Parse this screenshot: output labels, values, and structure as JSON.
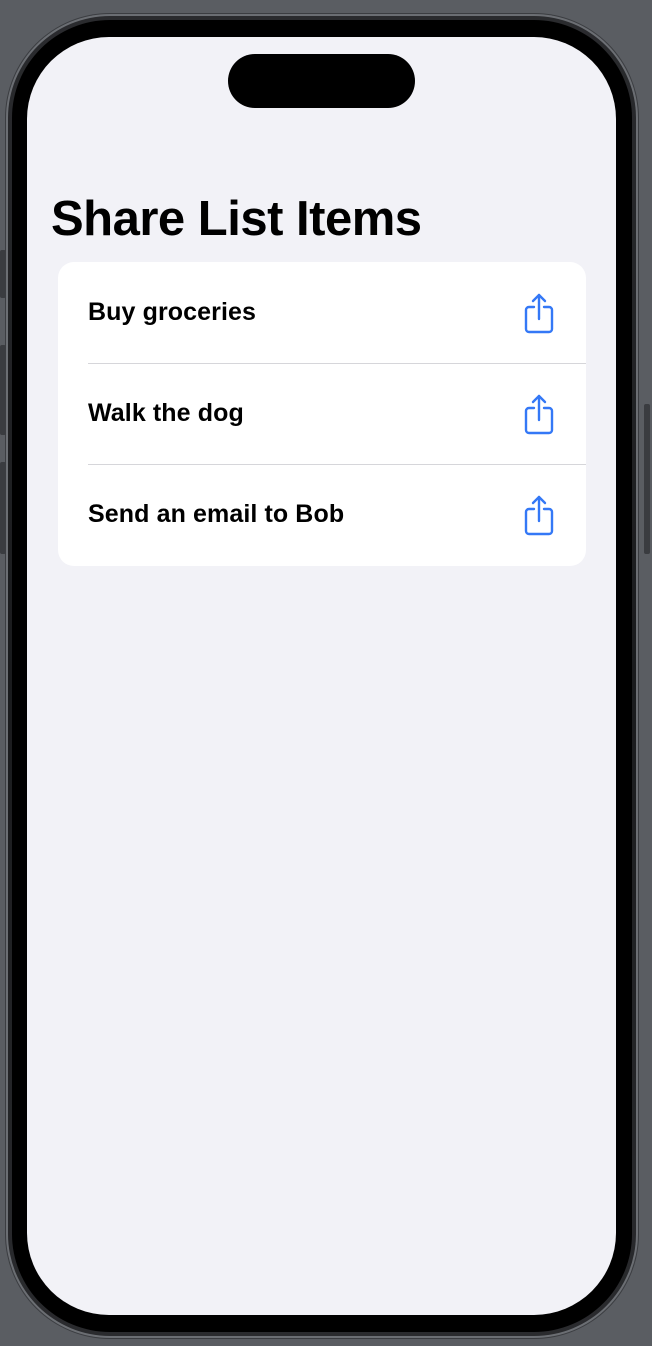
{
  "app": {
    "title": "Share List Items"
  },
  "list": {
    "items": [
      {
        "label": "Buy groceries",
        "action_icon": "share-icon"
      },
      {
        "label": "Walk the dog",
        "action_icon": "share-icon"
      },
      {
        "label": "Send an email to Bob",
        "action_icon": "share-icon"
      }
    ]
  },
  "colors": {
    "accent": "#3478f6",
    "background": "#f2f2f7",
    "card": "#ffffff",
    "text": "#000000"
  }
}
